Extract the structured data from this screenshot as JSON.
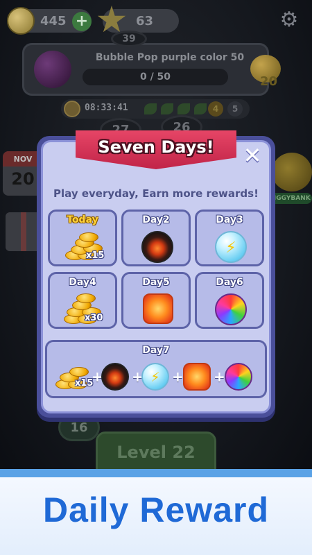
{
  "hud": {
    "coins": "445",
    "plus": "+",
    "stars": "63",
    "settings_icon": "gear-icon"
  },
  "goal": {
    "title": "Bubble Pop purple color 50",
    "progress": "0 / 50",
    "reward": "20"
  },
  "status": {
    "timer": "08:33:41",
    "count_a": "4",
    "count_b": "5"
  },
  "map": {
    "node_top": "39",
    "node_27": "27",
    "node_26": "26",
    "node_16": "16",
    "calendar_month": "NOV",
    "calendar_day": "20",
    "piggy_label": "PIGGYBANK",
    "level_button": "Level 22"
  },
  "dialog": {
    "title": "Seven Days!",
    "close": "✕",
    "subtitle": "Play everyday, Earn more rewards!",
    "days": [
      {
        "label": "Today",
        "qty": "x15",
        "reward": "coins"
      },
      {
        "label": "Day2",
        "reward": "bomb"
      },
      {
        "label": "Day3",
        "reward": "lightning"
      },
      {
        "label": "Day4",
        "qty": "x30",
        "reward": "coins"
      },
      {
        "label": "Day5",
        "reward": "fire"
      },
      {
        "label": "Day6",
        "reward": "rainbow"
      }
    ],
    "day7": {
      "label": "Day7",
      "qty": "x15",
      "plus": "+",
      "rewards": [
        "coins",
        "bomb",
        "lightning",
        "fire",
        "rainbow"
      ]
    }
  },
  "banner": {
    "text": "Daily Reward"
  },
  "colors": {
    "ribbon": "#d8345a",
    "modal_border": "#4a4f9a",
    "modal_fill": "#c9cdf0",
    "banner_text": "#1f69d6",
    "today_label": "#ffd23a"
  }
}
